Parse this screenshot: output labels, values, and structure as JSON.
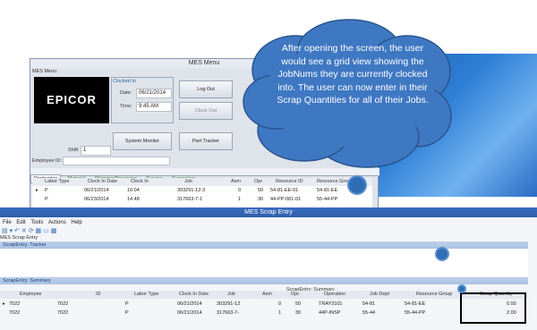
{
  "mes_menu": {
    "window_title": "MES Menu",
    "subtitle": "MES Menu",
    "logo_text": "EPICOR",
    "clocked_in_label": "Clocked In",
    "date_label": "Date:",
    "date_value": "06/21/2014",
    "time_label": "Time:",
    "time_value": "9:45 AM",
    "buttons": {
      "log_out": "Log Out",
      "clock_out": "Clock Out",
      "system_monitor": "System Monitor",
      "part_tracker": "Part Tracker"
    },
    "shift_label": "Shift:",
    "shift_value": "1",
    "employee_label": "Employee ID:",
    "tabs": [
      "Production",
      "Material",
      "Shipping/Receiving",
      "Service",
      "Supervisor"
    ],
    "grid_headers": [
      "Labor Type",
      "Clock In Date",
      "Clock In",
      "Job",
      "Asm",
      "Opr",
      "Resource ID",
      "Resource Group"
    ],
    "grid_rows": [
      [
        "P",
        "06/21/2014",
        "10.04",
        "303291-12-3",
        "0",
        "50",
        "54-81-EE-01",
        "54-81-EE"
      ],
      [
        "P",
        "06/23/2014",
        "14.48",
        "317663-7-1",
        "1",
        "30",
        "44-PP-081-01",
        "55-44-PP"
      ]
    ]
  },
  "scrap_entry": {
    "window_title": "MES Scrap Entry",
    "menu_items": [
      "File",
      "Edit",
      "Tools",
      "Actions",
      "Help"
    ],
    "section_label": "MES Scrap Entry",
    "tracker_band": "ScrapEntry: Tracker",
    "summary_band": "ScrapEntry: Summary",
    "summary_caption": "ScrapEntry: Summary",
    "columns": [
      "Employee",
      "ID",
      "Labor Type",
      "Clock In Date",
      "Job",
      "Asm",
      "Opr",
      "Operation",
      "Job Dept",
      "Resource Group",
      "Scrap Quantity"
    ],
    "rows": [
      [
        "7022",
        "7022",
        "P",
        "06/21/2014",
        "303291-12",
        "0",
        "50",
        "TRAY3101",
        "54-81",
        "54-81-EE",
        "0.00"
      ],
      [
        "7022",
        "7022",
        "P",
        "06/21/2014",
        "317663-7-",
        "1",
        "30",
        "44P-INSP",
        "55-44",
        "55-44-PP",
        "2.00"
      ]
    ]
  },
  "callout": {
    "text": "After opening the screen, the user would see a grid view showing the JobNums they are currently clocked into.  The user can now enter in their Scrap Quantities for all of their Jobs."
  },
  "colors": {
    "callout_fill": "#3f78c2",
    "title_bar": "#2f5da9",
    "band": "#b3c8e6"
  }
}
